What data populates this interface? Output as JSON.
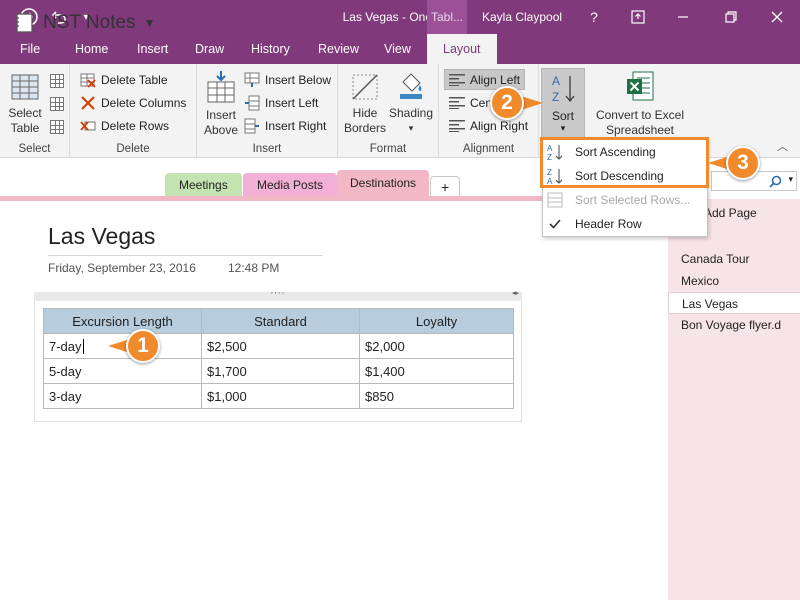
{
  "window": {
    "title": "Las Vegas - OneNote",
    "context_tab_head": "Tabl...",
    "user": "Kayla Claypool",
    "help": "?"
  },
  "tabs": [
    "File",
    "Home",
    "Insert",
    "Draw",
    "History",
    "Review",
    "View",
    "Layout"
  ],
  "ribbon": {
    "select": {
      "label": "Select Table",
      "line1": "Select",
      "line2": "Table",
      "group": "Select"
    },
    "delete": {
      "table": "Delete Table",
      "columns": "Delete Columns",
      "rows": "Delete Rows",
      "group": "Delete"
    },
    "insert": {
      "above1": "Insert",
      "above2": "Above",
      "below": "Insert Below",
      "left": "Insert Left",
      "right": "Insert Right",
      "group": "Insert"
    },
    "format": {
      "hide1": "Hide",
      "hide2": "Borders",
      "shading": "Shading",
      "group": "Format"
    },
    "alignment": {
      "left": "Align Left",
      "center": "Cen",
      "right": "Align Right",
      "group": "Alignment"
    },
    "sort": {
      "label": "Sort"
    },
    "convert": {
      "line1": "Convert to Excel",
      "line2": "Spreadsheet"
    }
  },
  "notebook": {
    "name": "NST Notes",
    "sections": [
      {
        "label": "Meetings",
        "color": "#c3e3b0"
      },
      {
        "label": "Media Posts",
        "color": "#f3b0d6"
      },
      {
        "label": "Destinations",
        "color": "#f2b8c6"
      }
    ],
    "add_tab": "+"
  },
  "page": {
    "title": "Las Vegas",
    "date": "Friday, September 23, 2016",
    "time": "12:48 PM"
  },
  "table": {
    "headers": [
      "Excursion Length",
      "Standard",
      "Loyalty"
    ],
    "rows": [
      [
        "7-day",
        "$2,500",
        "$2,000"
      ],
      [
        "5-day",
        "$1,700",
        "$1,400"
      ],
      [
        "3-day",
        "$1,000",
        "$850"
      ]
    ]
  },
  "pages_panel": {
    "add_page": "Add Page",
    "items": [
      "Canada Tour",
      "Mexico",
      "Las Vegas",
      "Bon Voyage flyer.d"
    ],
    "selected": "Las Vegas"
  },
  "sort_menu": {
    "ascending": "Sort Ascending",
    "descending": "Sort Descending",
    "selected_rows": "Sort Selected Rows...",
    "header_row": "Header Row"
  },
  "callouts": [
    "1",
    "2",
    "3"
  ],
  "colors": {
    "accent": "#80397b",
    "callout": "#f08a2b",
    "table_header": "#b7ccdc",
    "page_list_bg": "#f7e4e8"
  }
}
